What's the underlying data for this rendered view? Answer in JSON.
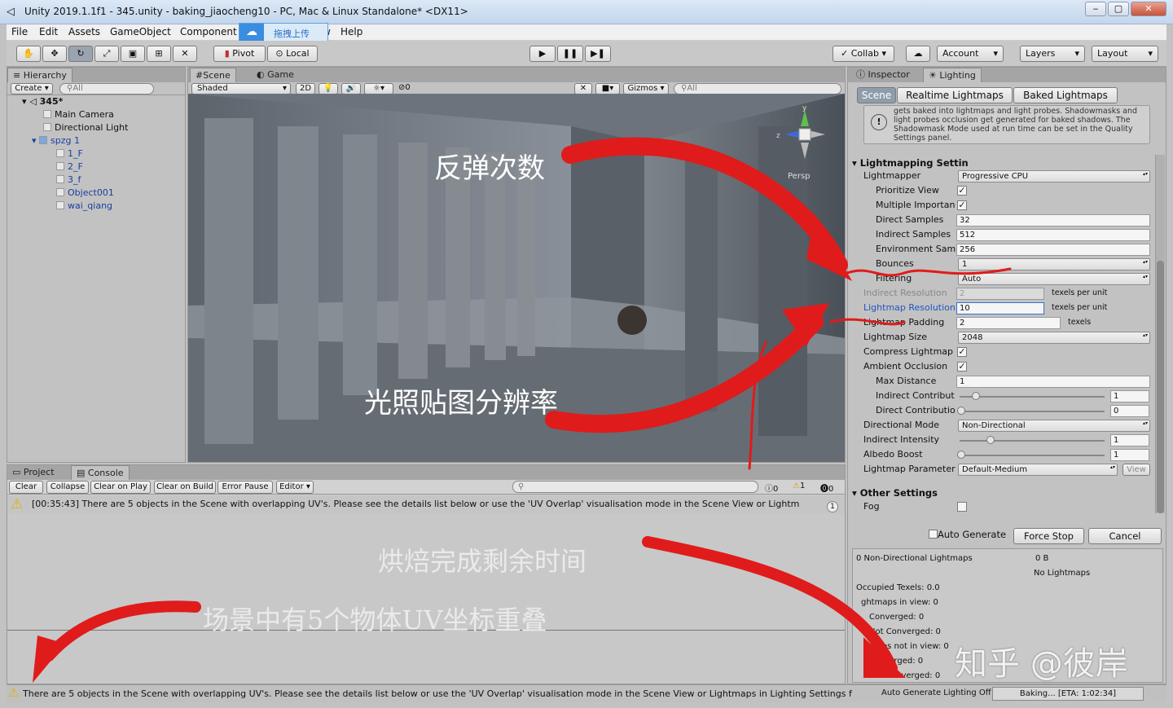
{
  "window": {
    "title": "Unity 2019.1.1f1 - 345.unity - baking_jiaocheng10 - PC, Mac & Linux Standalone* <DX11>"
  },
  "menu": [
    "File",
    "Edit",
    "Assets",
    "GameObject",
    "Component",
    "w",
    "Help"
  ],
  "upload_badge": "拖拽上传",
  "toolbar": {
    "pivot": "Pivot",
    "local": "Local",
    "collab": "Collab ▾",
    "account": "Account",
    "layers": "Layers",
    "layout": "Layout"
  },
  "hierarchy": {
    "tab": "Hierarchy",
    "create": "Create",
    "search_placeholder": "All",
    "scene": "345*",
    "items": [
      "Main Camera",
      "Directional Light",
      "spzg 1",
      "1_F",
      "2_F",
      "3_f",
      "Object001",
      "wai_qiang"
    ]
  },
  "scene_view": {
    "tab_scene": "Scene",
    "tab_game": "Game",
    "shading": "Shaded",
    "mode_2d": "2D",
    "effects_count": "0",
    "gizmos": "Gizmos",
    "search_placeholder": "All",
    "persp": "Persp"
  },
  "console": {
    "tab_project": "Project",
    "tab_console": "Console",
    "buttons": [
      "Clear",
      "Collapse",
      "Clear on Play",
      "Clear on Build",
      "Error Pause",
      "Editor"
    ],
    "counts": {
      "info": "0",
      "warn": "1",
      "error": "0"
    },
    "message": "[00:35:43] There are 5 objects in the Scene with overlapping UV's. Please see the details list below or use the 'UV Overlap' visualisation mode in the Scene View or Lightm",
    "message_count": "1"
  },
  "status_bar": {
    "message": "There are 5 objects in the Scene with overlapping UV's. Please see the details list below or use the 'UV Overlap' visualisation mode in the Scene View or Lightmaps in Lighting Settings f",
    "auto": "Auto Generate Lighting Off",
    "baking": "Baking... [ETA: 1:02:34]"
  },
  "inspector": {
    "tab_inspector": "Inspector",
    "tab_lighting": "Lighting",
    "subtabs": [
      "Scene",
      "Realtime Lightmaps",
      "Baked Lightmaps"
    ],
    "info_text": "gets baked into lightmaps and light probes. Shadowmasks and light probes occlusion get generated for baked shadows. The Shadowmask Mode used at run time can be set in the Quality Settings panel.",
    "section_lightmapping": "Lightmapping Settin",
    "rows": [
      {
        "label": "Lightmapper",
        "value": "Progressive CPU",
        "kind": "dropdown"
      },
      {
        "label": "Prioritize View",
        "value": "✓",
        "kind": "check"
      },
      {
        "label": "Multiple Importan",
        "value": "✓",
        "kind": "check"
      },
      {
        "label": "Direct Samples",
        "value": "32",
        "kind": "field"
      },
      {
        "label": "Indirect Samples",
        "value": "512",
        "kind": "field"
      },
      {
        "label": "Environment Sam",
        "value": "256",
        "kind": "field"
      },
      {
        "label": "Bounces",
        "value": "1",
        "kind": "dropdown"
      },
      {
        "label": "Filtering",
        "value": "Auto",
        "kind": "dropdown"
      },
      {
        "label": "Indirect Resolution",
        "value": "2",
        "kind": "field",
        "unit": "texels per unit"
      },
      {
        "label": "Lightmap Resolution",
        "value": "10",
        "kind": "field",
        "unit": "texels per unit"
      },
      {
        "label": "Lightmap Padding",
        "value": "2",
        "kind": "field",
        "unit": "texels"
      },
      {
        "label": "Lightmap Size",
        "value": "2048",
        "kind": "dropdown"
      },
      {
        "label": "Compress Lightmap",
        "value": "✓",
        "kind": "check"
      },
      {
        "label": "Ambient Occlusion",
        "value": "✓",
        "kind": "check"
      },
      {
        "label": "Max Distance",
        "value": "1",
        "kind": "field"
      },
      {
        "label": "Indirect Contribut",
        "value": "1",
        "kind": "slider"
      },
      {
        "label": "Direct Contributio",
        "value": "0",
        "kind": "slider"
      },
      {
        "label": "Directional Mode",
        "value": "Non-Directional",
        "kind": "dropdown"
      },
      {
        "label": "Indirect Intensity",
        "value": "1",
        "kind": "slider"
      },
      {
        "label": "Albedo Boost",
        "value": "1",
        "kind": "slider"
      },
      {
        "label": "Lightmap Parameter",
        "value": "Default-Medium",
        "kind": "dropdown"
      }
    ],
    "view_button": "View",
    "section_other": "Other Settings",
    "fog_label": "Fog",
    "auto_generate": "Auto Generate",
    "force_stop": "Force Stop",
    "cancel": "Cancel",
    "stats": {
      "lightmaps": "0 Non-Directional Lightmaps",
      "size": "0 B",
      "no_lightmaps": "No Lightmaps",
      "lines": [
        "Occupied Texels: 0.0",
        "ghtmaps in view: 0",
        "Converged: 0",
        "Not Converged: 0",
        "tmaps not in view: 0",
        "nverged: 0",
        "Converged: 0"
      ]
    }
  },
  "annotations": {
    "bounces": "反弹次数",
    "resolution": "光照贴图分辨率",
    "eta": "烘焙完成剩余时间",
    "overlap": "场景中有5个物体UV坐标重叠",
    "watermark": "知乎 @彼岸"
  }
}
